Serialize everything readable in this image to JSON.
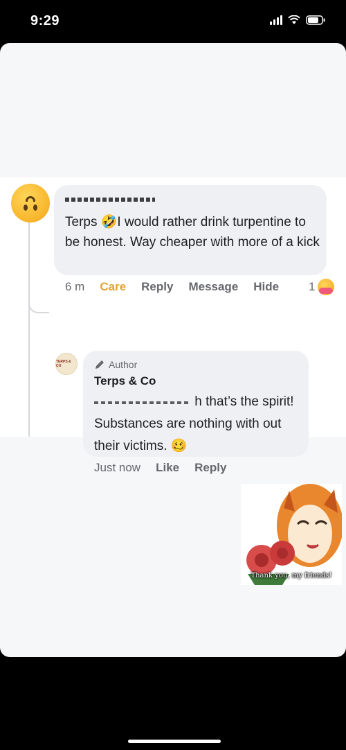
{
  "status_bar": {
    "time": "9:29",
    "icons": [
      "signal-icon",
      "wifi-icon",
      "battery-icon"
    ]
  },
  "comment": {
    "avatar_icon": "upside-down-face-emoji",
    "text": "Terps 🤣I would rather drink turpentine to be honest. Way cheaper with more of a kick",
    "actions": {
      "time": "6 m",
      "care": "Care",
      "reply": "Reply",
      "message": "Message",
      "hide": "Hide"
    },
    "reaction_count": "1",
    "reaction_icon": "care-emoji"
  },
  "reply": {
    "avatar_text": "TERPS & CO",
    "author_badge": "Author",
    "author_badge_icon": "pencil-icon",
    "author_name": "Terps & Co",
    "text_after_mention": "h that’s the spirit!",
    "text_rest": "Substances are nothing with out their victims. 🥴",
    "actions": {
      "time": "Just now",
      "like": "Like",
      "reply": "Reply"
    }
  },
  "sticker": {
    "caption": "Thank you, my friends!"
  },
  "colors": {
    "care": "#e4a233",
    "bubble": "#eff0f3",
    "meta": "#65676b",
    "text": "#1c1e21"
  }
}
